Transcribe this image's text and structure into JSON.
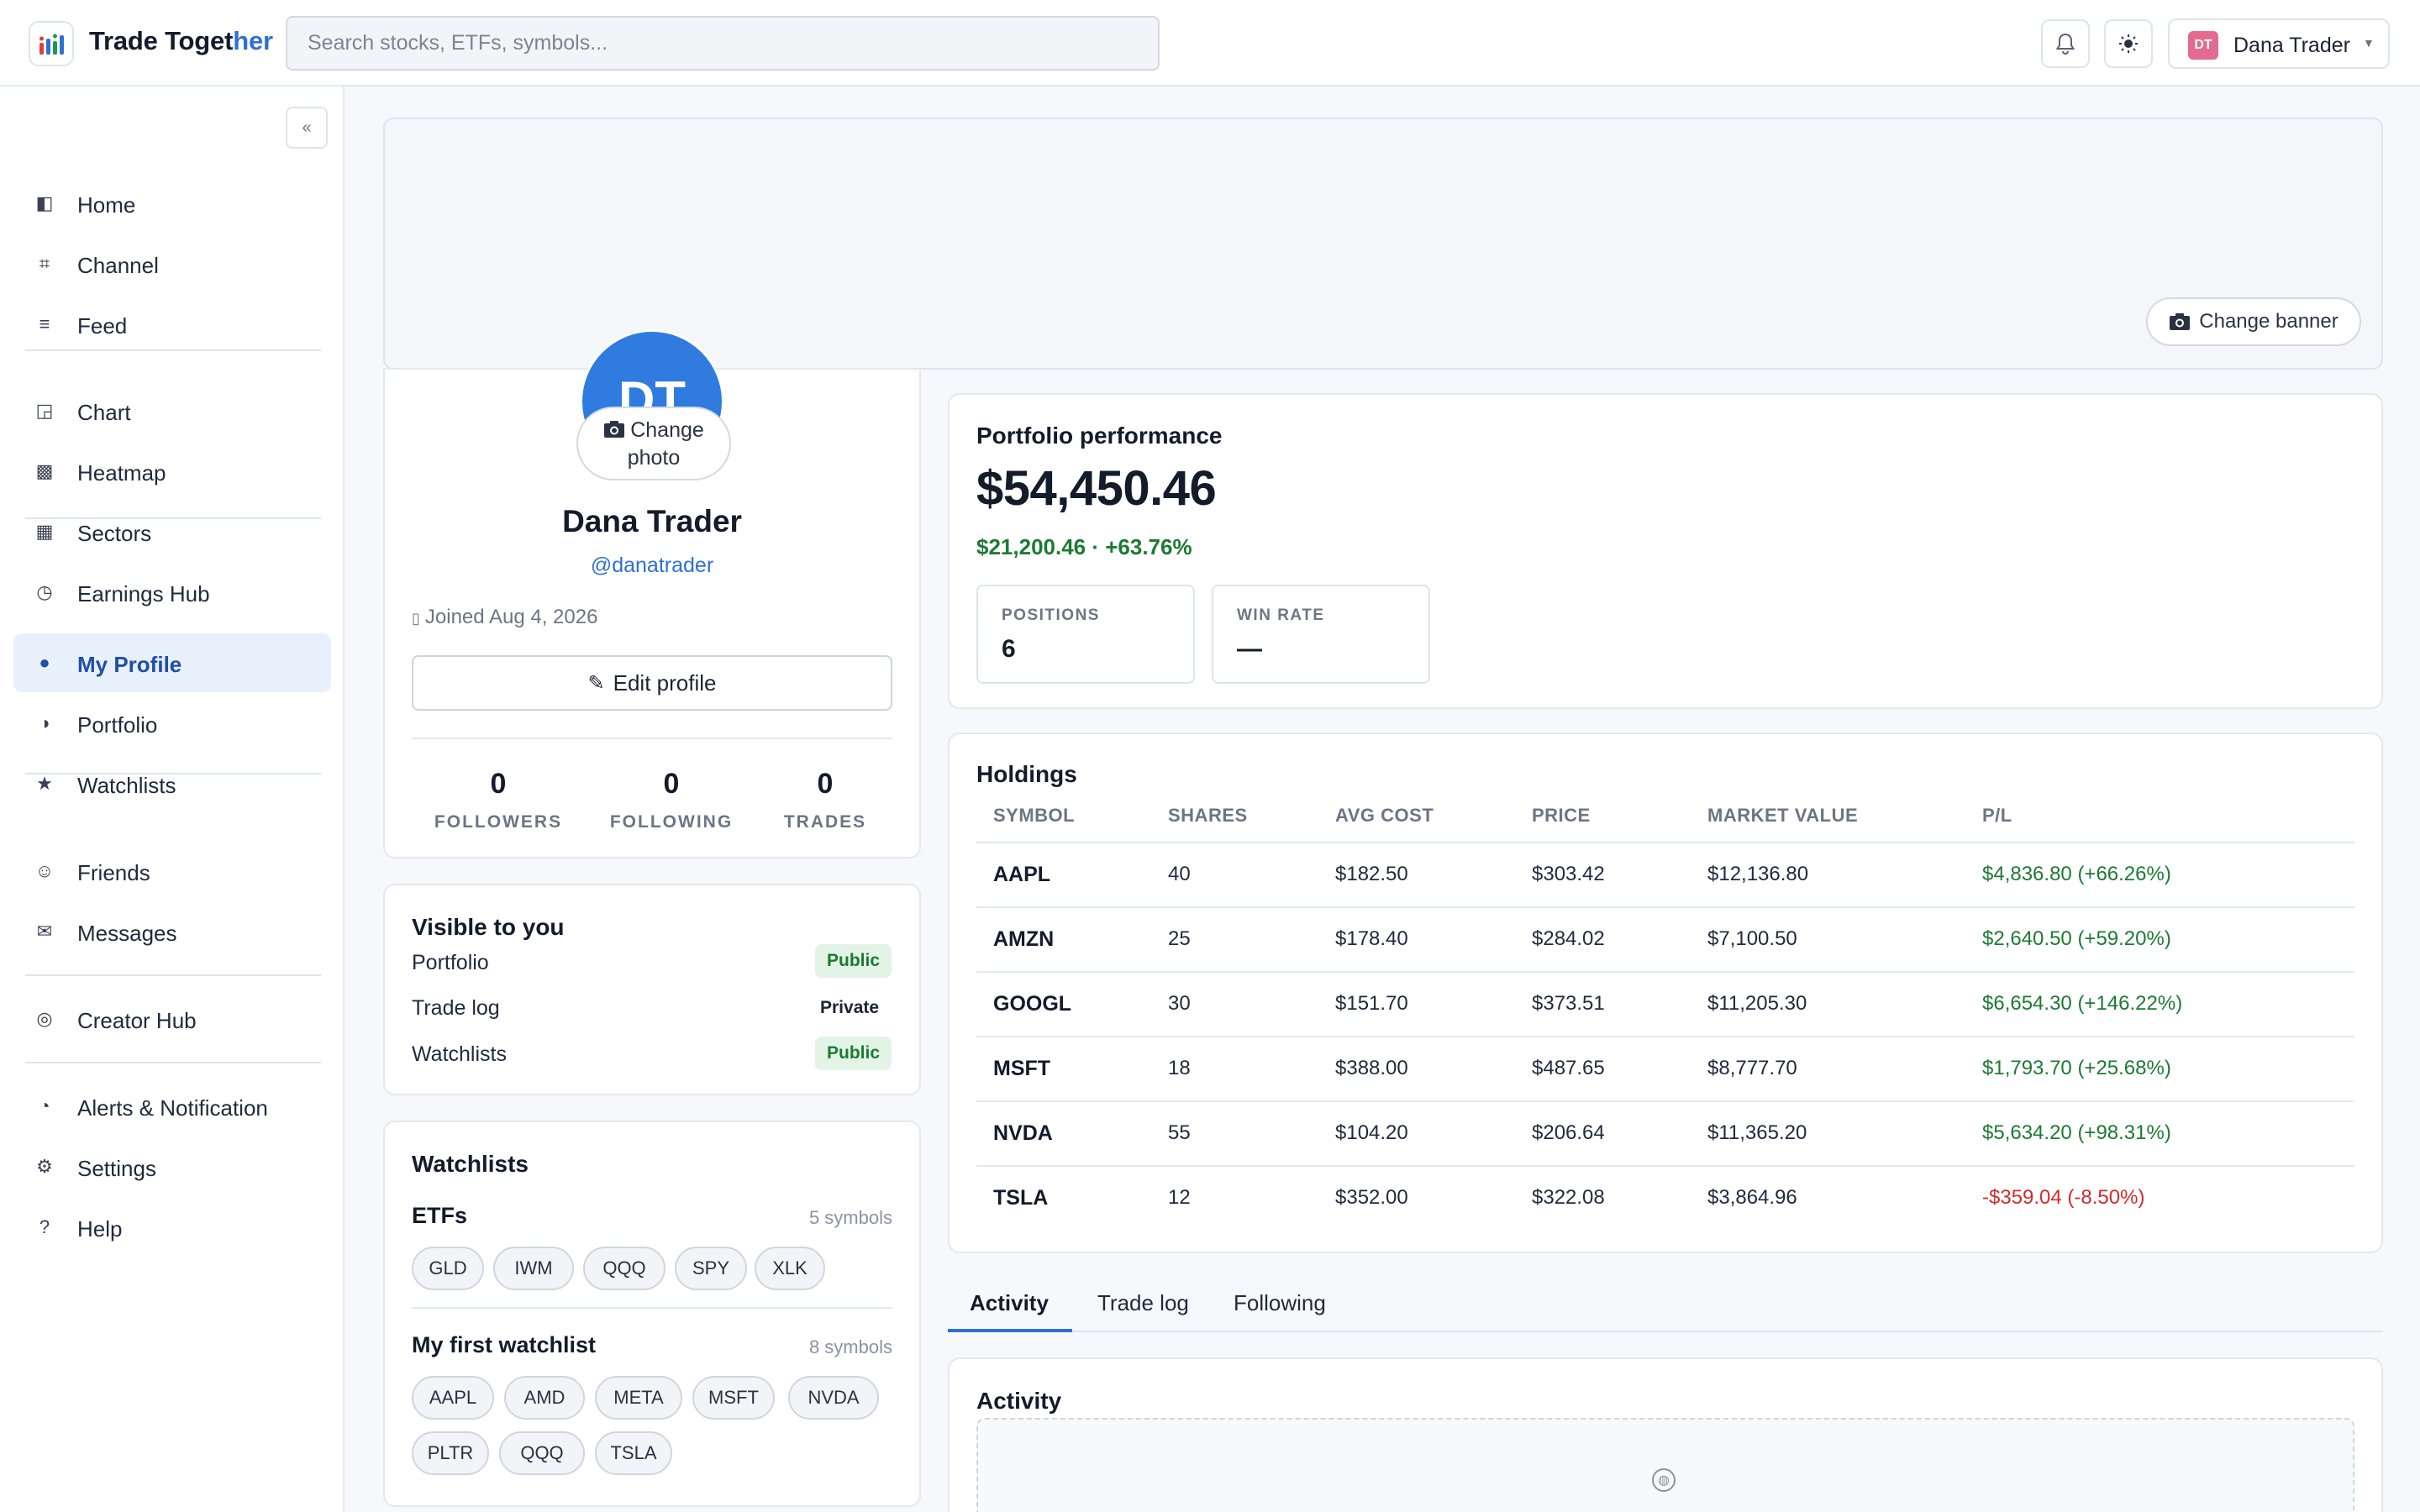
{
  "header": {
    "brand_main": "Trade Toget",
    "brand_accent": "her",
    "search_placeholder": "Search stocks, ETFs, symbols...",
    "user_initials": "DT",
    "user_name": "Dana Trader",
    "icons": [
      "bell-icon",
      "sun-icon",
      "chevron-down-icon"
    ]
  },
  "sidebar": {
    "collapse_label": "«",
    "groups": [
      [
        {
          "label": "Home",
          "icon": "◧"
        },
        {
          "label": "Channel",
          "icon": "⌗"
        },
        {
          "label": "Feed",
          "icon": "≡"
        }
      ],
      [
        {
          "label": "Chart",
          "icon": "◲"
        },
        {
          "label": "Heatmap",
          "icon": "▩"
        },
        {
          "label": "Sectors",
          "icon": "▦"
        },
        {
          "label": "Earnings Hub",
          "icon": "◷"
        }
      ],
      [
        {
          "label": "My Profile",
          "icon": "●",
          "active": true
        },
        {
          "label": "Portfolio",
          "icon": "◑"
        },
        {
          "label": "Watchlists",
          "icon": "★"
        }
      ],
      [
        {
          "label": "Friends",
          "icon": "☺"
        },
        {
          "label": "Messages",
          "icon": "✉"
        }
      ],
      [
        {
          "label": "Creator Hub",
          "icon": "◎"
        }
      ],
      [
        {
          "label": "Alerts & Notification",
          "icon": "◔"
        },
        {
          "label": "Settings",
          "icon": "⚙"
        },
        {
          "label": "Help",
          "icon": "?"
        }
      ]
    ]
  },
  "banner": {
    "change_banner_label": "Change banner"
  },
  "profile": {
    "initials": "DT",
    "change_photo_line1": "Change",
    "change_photo_line2": "photo",
    "name": "Dana Trader",
    "handle": "@danatrader",
    "joined": "Joined Aug 4, 2026",
    "edit_label": "Edit profile",
    "stats": [
      {
        "value": "0",
        "label": "FOLLOWERS"
      },
      {
        "value": "0",
        "label": "FOLLOWING"
      },
      {
        "value": "0",
        "label": "TRADES"
      }
    ]
  },
  "visibility": {
    "title": "Visible to you",
    "rows": [
      {
        "label": "Portfolio",
        "status": "Public"
      },
      {
        "label": "Trade log",
        "status": "Private"
      },
      {
        "label": "Watchlists",
        "status": "Public"
      }
    ]
  },
  "watchlists": {
    "title": "Watchlists",
    "lists": [
      {
        "name": "ETFs",
        "count": "5 symbols",
        "symbols": [
          "GLD",
          "IWM",
          "QQQ",
          "SPY",
          "XLK"
        ]
      },
      {
        "name": "My first watchlist",
        "count": "8 symbols",
        "symbols": [
          "AAPL",
          "AMD",
          "META",
          "MSFT",
          "NVDA",
          "PLTR",
          "QQQ",
          "TSLA"
        ]
      }
    ]
  },
  "performance": {
    "title": "Portfolio performance",
    "value": "$54,450.46",
    "change": "$21,200.46 · +63.76%",
    "positions_label": "POSITIONS",
    "positions_value": "6",
    "winrate_label": "WIN RATE",
    "winrate_value": "—"
  },
  "holdings": {
    "title": "Holdings",
    "columns": [
      "SYMBOL",
      "SHARES",
      "AVG COST",
      "PRICE",
      "MARKET VALUE",
      "P/L"
    ],
    "rows": [
      {
        "symbol": "AAPL",
        "shares": "40",
        "avg_cost": "$182.50",
        "price": "$303.42",
        "market_value": "$12,136.80",
        "pl": "$4,836.80 (+66.26%)",
        "positive": true
      },
      {
        "symbol": "AMZN",
        "shares": "25",
        "avg_cost": "$178.40",
        "price": "$284.02",
        "market_value": "$7,100.50",
        "pl": "$2,640.50 (+59.20%)",
        "positive": true
      },
      {
        "symbol": "GOOGL",
        "shares": "30",
        "avg_cost": "$151.70",
        "price": "$373.51",
        "market_value": "$11,205.30",
        "pl": "$6,654.30 (+146.22%)",
        "positive": true
      },
      {
        "symbol": "MSFT",
        "shares": "18",
        "avg_cost": "$388.00",
        "price": "$487.65",
        "market_value": "$8,777.70",
        "pl": "$1,793.70 (+25.68%)",
        "positive": true
      },
      {
        "symbol": "NVDA",
        "shares": "55",
        "avg_cost": "$104.20",
        "price": "$206.64",
        "market_value": "$11,365.20",
        "pl": "$5,634.20 (+98.31%)",
        "positive": true
      },
      {
        "symbol": "TSLA",
        "shares": "12",
        "avg_cost": "$352.00",
        "price": "$322.08",
        "market_value": "$3,864.96",
        "pl": "-$359.04 (-8.50%)",
        "positive": false
      }
    ]
  },
  "tabs": [
    {
      "label": "Activity",
      "active": true
    },
    {
      "label": "Trade log"
    },
    {
      "label": "Following"
    }
  ],
  "activity": {
    "title": "Activity"
  },
  "colors": {
    "accent": "#2f6fd6",
    "positive": "#1d7a33",
    "negative": "#d12c2c",
    "avatar": "#2f7be0",
    "user_badge": "#e36b8f"
  }
}
